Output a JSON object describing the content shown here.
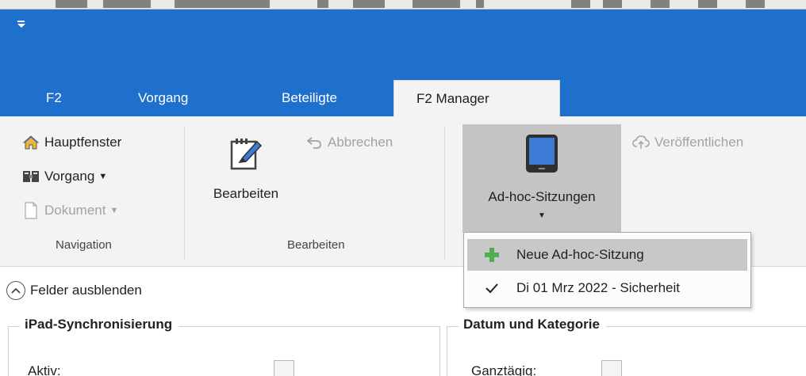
{
  "window": {
    "quick_access_icon": "customize-toolbar-icon"
  },
  "tabs": [
    {
      "label": "F2"
    },
    {
      "label": "Vorgang"
    },
    {
      "label": "Beteiligte"
    },
    {
      "label": "F2 Manager",
      "active": true
    }
  ],
  "ribbon": {
    "navigation": {
      "group_label": "Navigation",
      "items": [
        {
          "label": "Hauptfenster",
          "icon": "home-icon"
        },
        {
          "label": "Vorgang",
          "icon": "case-folder-icon",
          "dropdown": true
        },
        {
          "label": "Dokument",
          "icon": "document-icon",
          "dropdown": true,
          "disabled": true
        }
      ]
    },
    "bearbeiten": {
      "group_label": "Bearbeiten",
      "edit_label": "Bearbeiten",
      "edit_icon": "notepad-pencil-icon",
      "cancel_label": "Abbrechen",
      "cancel_icon": "undo-arrow-icon"
    },
    "adhoc": {
      "label": "Ad-hoc-Sitzungen",
      "icon": "tablet-icon",
      "publish_label": "Veröffentlichen",
      "publish_icon": "cloud-upload-icon"
    }
  },
  "dropdown_menu": {
    "items": [
      {
        "label": "Neue Ad-hoc-Sitzung",
        "icon": "plus-icon"
      },
      {
        "label": "Di 01 Mrz 2022 - Sicherheit",
        "icon": "checkmark-icon"
      }
    ]
  },
  "body": {
    "toggle_fields_label": "Felder ausblenden",
    "ipad_section": {
      "title": "iPad-Synchronisierung",
      "field_label": "Aktiv:"
    },
    "date_section": {
      "title": "Datum und Kategorie",
      "field_label": "Ganztägig:"
    }
  },
  "colors": {
    "accent": "#1f6fcc",
    "ribbon_bg": "#f3f3f3",
    "pressed_bg": "#c4c4c4",
    "plus_green": "#4caf50"
  }
}
